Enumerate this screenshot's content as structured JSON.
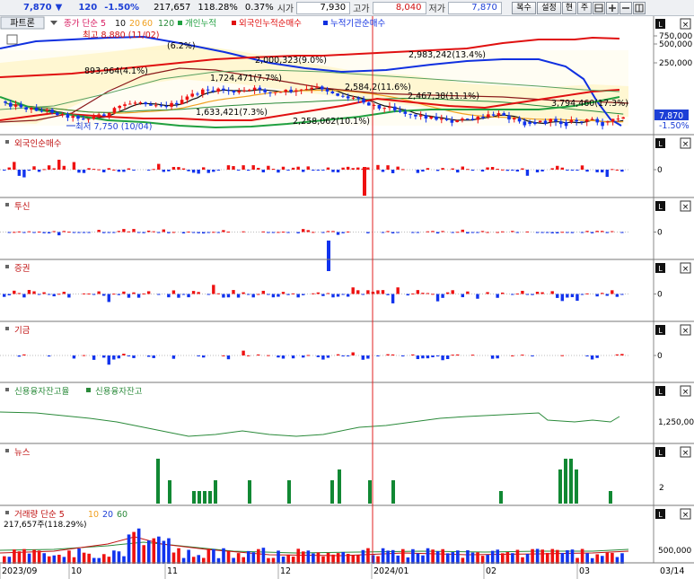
{
  "header": {
    "price": "7,870",
    "arrow": "▼",
    "period": "120",
    "change_pct": "-1.50%",
    "volume": "217,657",
    "volume_ratio": "118.28%",
    "turnover": "0.37%",
    "open_label": "시가",
    "open": "7,930",
    "high_label": "고가",
    "high": "8,040",
    "low_label": "저가",
    "low": "7,870",
    "buttons": [
      "복수",
      "설정",
      "현",
      "주"
    ]
  },
  "legend": {
    "tab": "파트론",
    "items": [
      "종가 단순 5",
      "10",
      "20",
      "60",
      "120",
      "개인누적",
      "외국인누적순매수",
      "누적기관순매수"
    ]
  },
  "annotations": {
    "high": "최고 8,880 (11/02)",
    "low": "최저 7,750 (10/04)",
    "labels": [
      "893,964(4.1%)",
      "(6.2%)",
      "1,724,471(7.7%)",
      "2,000,323(9.0%)",
      "2,983,242(13.4%)",
      "2,584,2(11.6%)",
      "2,467,38(11.1%)",
      "3,794,460(17.3%)",
      "1,633,421(7.3%)",
      "2,258,062(10.1%)"
    ]
  },
  "price_axis": {
    "ticks": [
      "750,000",
      "500,000",
      "250,000"
    ],
    "current": "7,870",
    "current_pct": "-1.50%"
  },
  "panels": {
    "foreign": {
      "title": "외국인순매수",
      "tick": "0"
    },
    "trust": {
      "title": "투신",
      "tick": "0"
    },
    "securities": {
      "title": "증권",
      "tick": "0"
    },
    "fund": {
      "title": "기금",
      "tick": "0"
    },
    "credit": {
      "title": "신용융자잔고율",
      "title2": "신용융자잔고",
      "tick": "1,250,000"
    },
    "news": {
      "title": "뉴스",
      "tick": "2"
    },
    "volume": {
      "title": "거래량 단순 5",
      "ma": [
        "10",
        "20",
        "60"
      ],
      "info": "217,657주(118.29%)",
      "tick": "500,000"
    }
  },
  "x_axis": {
    "labels": [
      "2023/09",
      "10",
      "11",
      "12",
      "2024/01",
      "02",
      "03"
    ],
    "right_label": "03/14"
  },
  "panel_buttons": [
    "L",
    "×"
  ],
  "colors": {
    "up": "#ee1111",
    "down": "#1133ee",
    "ma5": "#111111",
    "ma20": "#f0a020",
    "foreign": "#e01010",
    "institution": "#1030e0",
    "individual": "#20a040",
    "news": "#118833"
  }
}
